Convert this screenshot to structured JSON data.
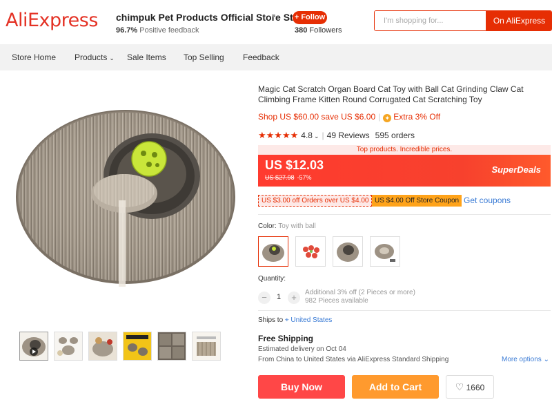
{
  "header": {
    "logo": "AliExpress",
    "store_name": "chimpuk Pet Products Official Store Sto...",
    "feedback_percent": "96.7%",
    "feedback_label": "Positive feedback",
    "follow_label": "+ Follow",
    "followers_count": "380",
    "followers_label": "Followers",
    "search_placeholder": "I'm shopping for...",
    "search_button": "On AliExpress"
  },
  "nav": {
    "items": [
      "Store Home",
      "Products",
      "Sale Items",
      "Top Selling",
      "Feedback"
    ]
  },
  "product": {
    "title": "Magic Cat Scratch Organ Board Cat Toy with Ball Cat Grinding Claw Cat Climbing Frame Kitten Round Corrugated Cat Scratching Toy",
    "promo_text": "Shop US $60.00 save US $6.00",
    "extra_off": "Extra 3% Off",
    "rating": "4.8",
    "reviews": "49 Reviews",
    "orders": "595 orders",
    "tagline": "Top products. Incredible prices.",
    "price": "US $12.03",
    "old_price": "US $27.98",
    "discount": "-57%",
    "superdeals": "SuperDeals",
    "coupon1": "US $3.00 off Orders over US $4.00",
    "coupon2": "US $4.00 Off Store Coupon",
    "get_coupons": "Get coupons",
    "color_label": "Color:",
    "color_value": "Toy with ball",
    "quantity_label": "Quantity:",
    "quantity": "1",
    "qty_additional": "Additional 3% off (2 Pieces or more)",
    "qty_available": "982 Pieces available",
    "ships_to_label": "Ships to",
    "ships_to_location": "United States",
    "shipping_title": "Free Shipping",
    "estimated_delivery": "Estimated delivery on Oct 04",
    "shipping_route": "From China to United States via AliExpress Standard Shipping",
    "more_options": "More options",
    "buy_now": "Buy Now",
    "add_to_cart": "Add to Cart",
    "wishlist_count": "1660"
  },
  "colors": {
    "brand": "#e62e04",
    "buy_now": "#ff4747",
    "add_to_cart": "#ff9a2e",
    "link": "#3a7bd5"
  }
}
